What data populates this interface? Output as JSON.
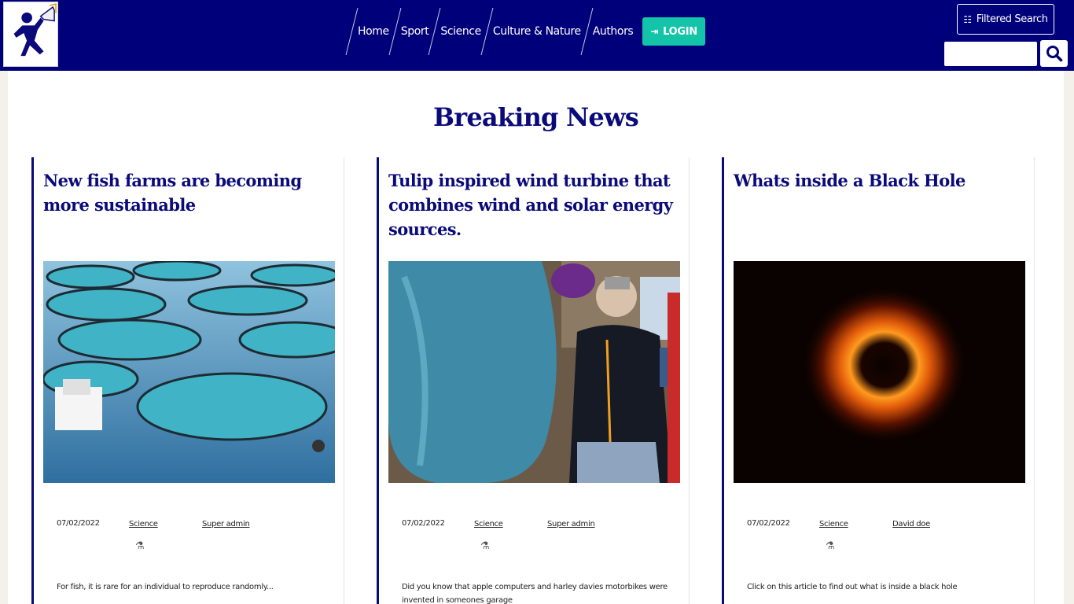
{
  "header": {
    "nav": [
      {
        "label": "Home"
      },
      {
        "label": "Sport"
      },
      {
        "label": "Science"
      },
      {
        "label": "Culture & Nature"
      },
      {
        "label": "Authors"
      }
    ],
    "login_label": "LOGIN",
    "filtered_search_label": "Filtered Search",
    "search_placeholder": ""
  },
  "main": {
    "title": "Breaking News",
    "cards": [
      {
        "title": "New fish farms are becoming more sustainable",
        "date": "07/02/2022",
        "category": "Science",
        "author": "Super admin",
        "category_icon": "flask-icon",
        "excerpt": "For fish, it is rare for an individual to reproduce randomly..."
      },
      {
        "title": "Tulip inspired wind turbine that combines wind and solar energy sources.",
        "date": "07/02/2022",
        "category": "Science",
        "author": "Super admin",
        "category_icon": "flask-icon",
        "excerpt": "Did you know that apple computers and harley davies motorbikes were invented in someones garage"
      },
      {
        "title": "Whats inside a Black Hole",
        "date": "07/02/2022",
        "category": "Science",
        "author": "David doe",
        "category_icon": "flask-icon",
        "excerpt": "Click on this article to find out what is inside a black hole"
      }
    ]
  },
  "colors": {
    "navy": "#00007a",
    "accent": "#13c4a8",
    "title": "#0a0a7a"
  }
}
